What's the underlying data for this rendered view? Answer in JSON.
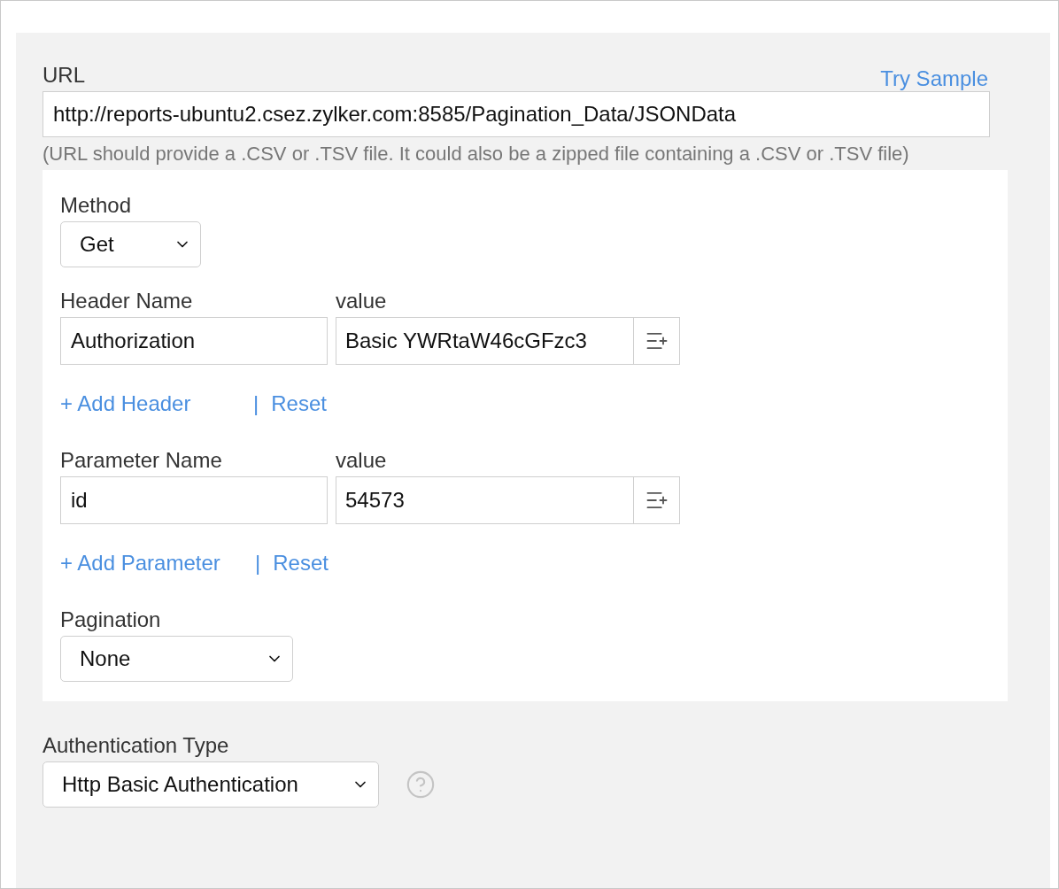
{
  "url": {
    "label": "URL",
    "link": "Try Sample",
    "value": "http://reports-ubuntu2.csez.zylker.com:8585/Pagination_Data/JSONData",
    "hint": "(URL should provide a .CSV or .TSV file. It could also be a zipped file containing a .CSV or .TSV file)"
  },
  "method": {
    "label": "Method",
    "value": "Get"
  },
  "groups": [
    {
      "name_label": "Header Name",
      "value_label": "value",
      "name": "Authorization",
      "value": "Basic YWRtaW46cGFzc3",
      "add": "+ Add Header",
      "separator": "|",
      "reset": "Reset"
    },
    {
      "name_label": "Parameter Name",
      "value_label": "value",
      "name": "id",
      "value": "54573",
      "add": "+ Add Parameter",
      "separator": "|",
      "reset": "Reset"
    }
  ],
  "pagination": {
    "label": "Pagination",
    "value": "None"
  },
  "authentication": {
    "label": "Authentication Type",
    "value": "Http Basic Authentication"
  }
}
